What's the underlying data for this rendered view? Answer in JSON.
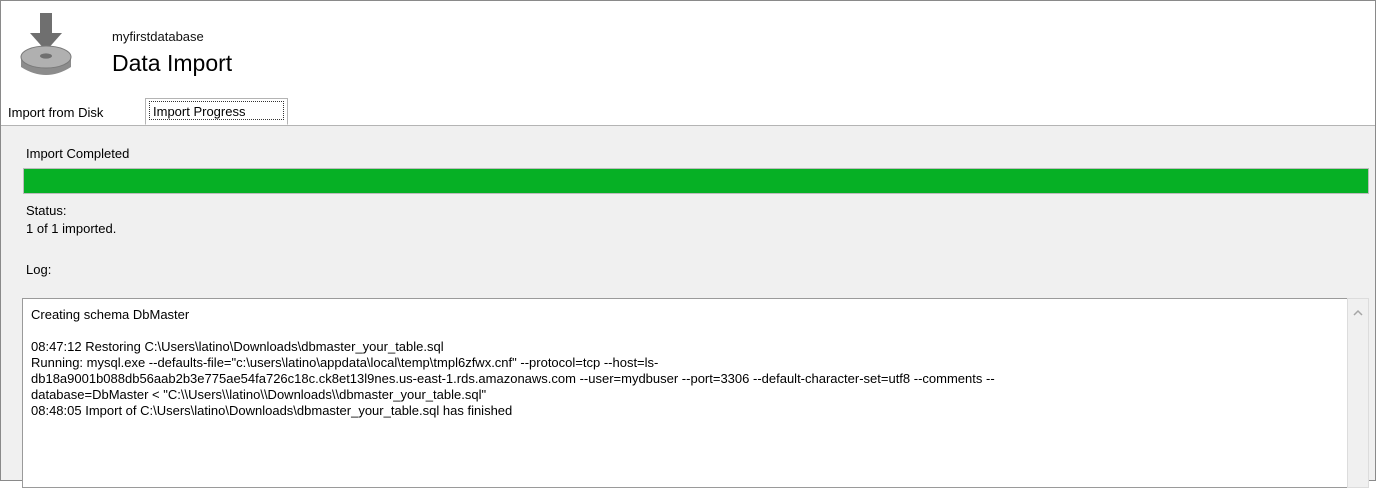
{
  "header": {
    "database_name": "myfirstdatabase",
    "title": "Data Import",
    "icon": "download-to-disk-icon"
  },
  "tabs": [
    {
      "label": "Import from Disk",
      "active": false
    },
    {
      "label": "Import Progress",
      "active": true
    }
  ],
  "progress": {
    "heading": "Import Completed",
    "fraction": 1.0,
    "color": "#06b025",
    "status_label": "Status:",
    "status_text": "1 of 1 imported."
  },
  "log": {
    "label": "Log:",
    "lines": [
      "Creating schema DbMaster",
      "",
      "08:47:12 Restoring C:\\Users\\latino\\Downloads\\dbmaster_your_table.sql",
      "Running: mysql.exe --defaults-file=\"c:\\users\\latino\\appdata\\local\\temp\\tmpl6zfwx.cnf\"  --protocol=tcp --host=ls-",
      "db18a9001b088db56aab2b3e775ae54fa726c18c.ck8et13l9nes.us-east-1.rds.amazonaws.com --user=mydbuser --port=3306 --default-character-set=utf8 --comments --",
      "database=DbMaster  < \"C:\\\\Users\\\\latino\\\\Downloads\\\\dbmaster_your_table.sql\"",
      "08:48:05 Import of C:\\Users\\latino\\Downloads\\dbmaster_your_table.sql has finished"
    ]
  }
}
